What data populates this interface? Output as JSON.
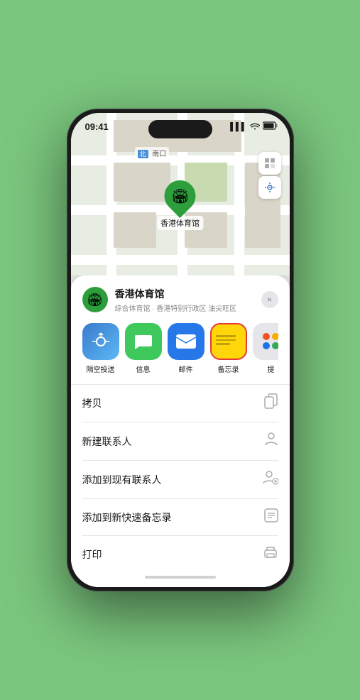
{
  "status_bar": {
    "time": "09:41",
    "signal": "▌▌▌",
    "wifi": "WiFi",
    "battery": "Battery"
  },
  "map": {
    "location_label": "南口",
    "pin_label": "香港体育馆"
  },
  "location_card": {
    "name": "香港体育馆",
    "subtitle": "综合体育馆 · 香港特别行政区 油尖旺区",
    "close_label": "×"
  },
  "share_items": [
    {
      "id": "airdrop",
      "label": "隔空投送"
    },
    {
      "id": "message",
      "label": "信息"
    },
    {
      "id": "mail",
      "label": "邮件"
    },
    {
      "id": "notes",
      "label": "备忘录"
    },
    {
      "id": "more",
      "label": "提"
    }
  ],
  "actions": [
    {
      "label": "拷贝",
      "icon": "copy"
    },
    {
      "label": "新建联系人",
      "icon": "person"
    },
    {
      "label": "添加到现有联系人",
      "icon": "person-add"
    },
    {
      "label": "添加到新快速备忘录",
      "icon": "note"
    },
    {
      "label": "打印",
      "icon": "print"
    }
  ]
}
